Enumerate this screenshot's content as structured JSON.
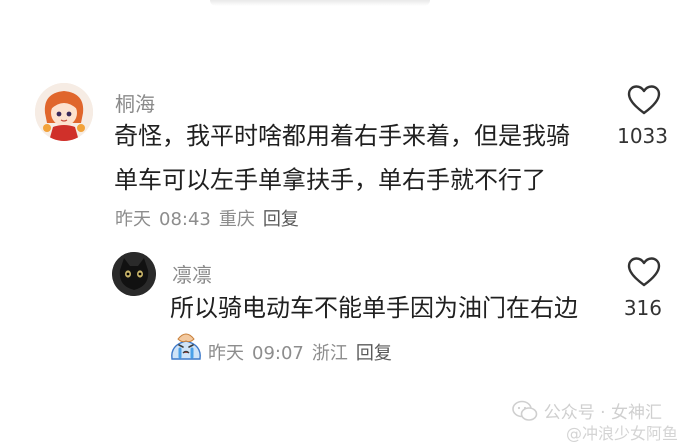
{
  "comments": [
    {
      "username": "桐海",
      "lines": [
        "奇怪，我平时啥都用着右手来着，但是我骑",
        "单车可以左手单拿扶手，单右手就不行了"
      ],
      "date": "昨天",
      "time": "08:43",
      "location": "重庆",
      "reply_label": "回复",
      "like_count": "1033",
      "icon": "heart-outline-icon"
    },
    {
      "username": "凛凛",
      "lines": [
        "所以骑电动车不能单手因为油门在右边"
      ],
      "date": "昨天",
      "time": "09:07",
      "location": "浙江",
      "reply_label": "回复",
      "like_count": "316",
      "icon": "heart-outline-icon"
    }
  ],
  "watermark": {
    "main": "公众号 · 女神汇",
    "sub": "@冲浪少女阿鱼"
  },
  "colors": {
    "text": "#202020",
    "secondary": "#8a8a8a",
    "watermark": "#cfcfcf"
  }
}
